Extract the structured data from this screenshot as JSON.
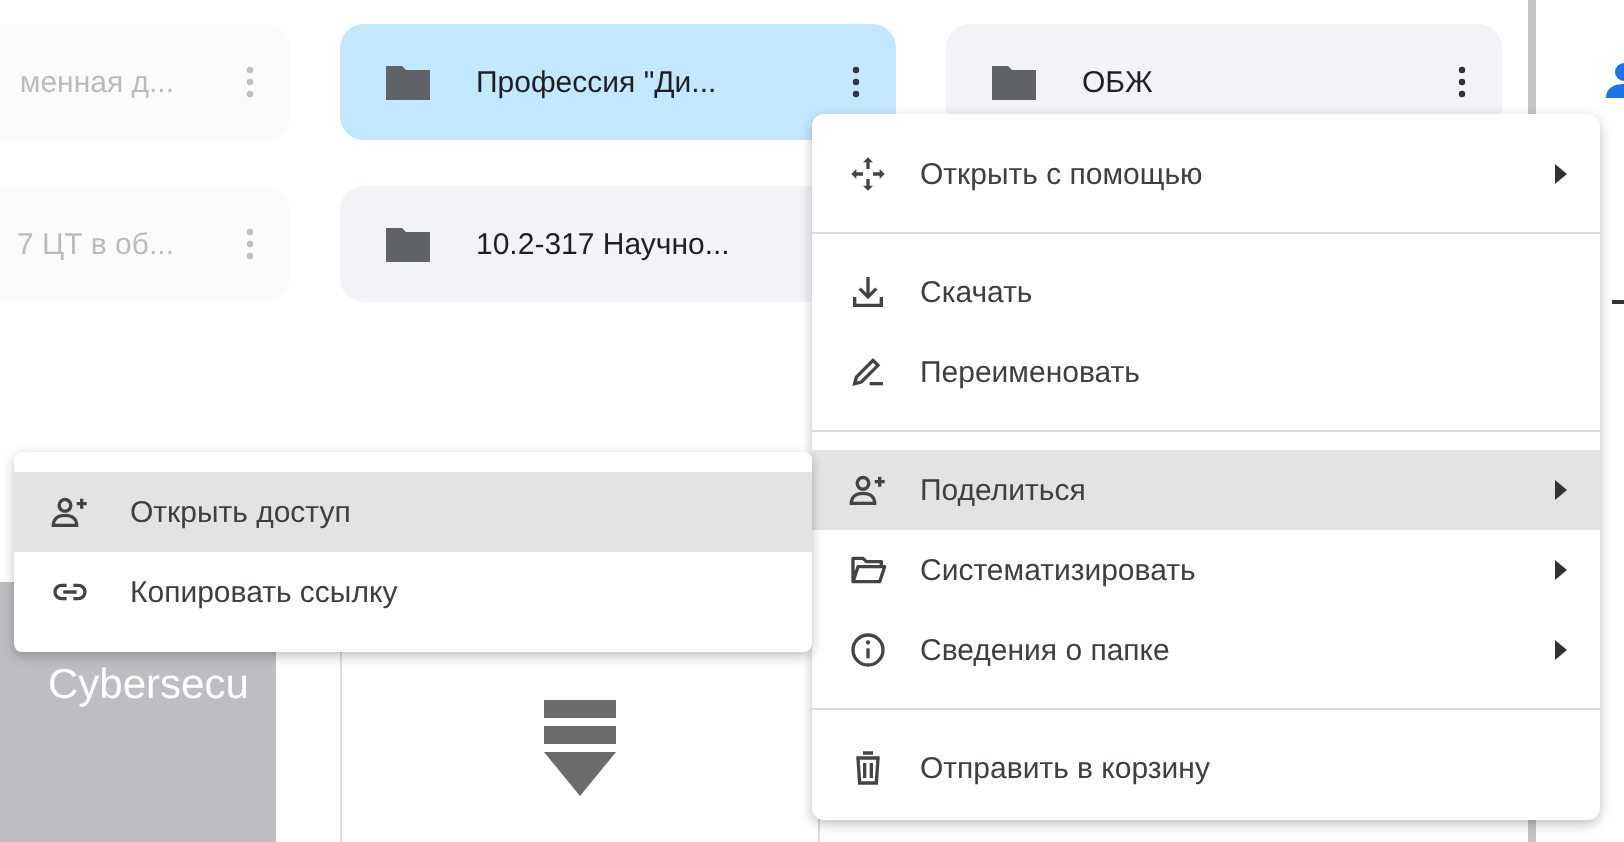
{
  "folders": [
    {
      "name": "менная д...",
      "dimmed": true,
      "selected": false
    },
    {
      "name": "Профессия \"Ди...",
      "dimmed": false,
      "selected": true
    },
    {
      "name": "ОБЖ",
      "dimmed": false,
      "selected": false
    },
    {
      "name": "7 ЦТ в об...",
      "dimmed": true,
      "selected": false
    },
    {
      "name": "10.2-317 Научно...",
      "dimmed": false,
      "selected": false
    }
  ],
  "thumbnails": [
    {
      "kind": "title-slide",
      "text": "Cybersecu"
    },
    {
      "kind": "file"
    }
  ],
  "context_menu": {
    "sections": [
      [
        {
          "label": "Открыть с помощью",
          "submenu": true,
          "highlighted": false
        }
      ],
      [
        {
          "label": "Скачать",
          "submenu": false,
          "highlighted": false
        },
        {
          "label": "Переименовать",
          "submenu": false,
          "highlighted": false
        }
      ],
      [
        {
          "label": "Поделиться",
          "submenu": true,
          "highlighted": true
        },
        {
          "label": "Систематизировать",
          "submenu": true,
          "highlighted": false
        },
        {
          "label": "Сведения о папке",
          "submenu": true,
          "highlighted": false
        }
      ],
      [
        {
          "label": "Отправить в корзину",
          "submenu": false,
          "highlighted": false
        }
      ]
    ]
  },
  "share_submenu": {
    "items": [
      {
        "label": "Открыть доступ",
        "highlighted": true
      },
      {
        "label": "Копировать ссылку",
        "highlighted": false
      }
    ]
  }
}
